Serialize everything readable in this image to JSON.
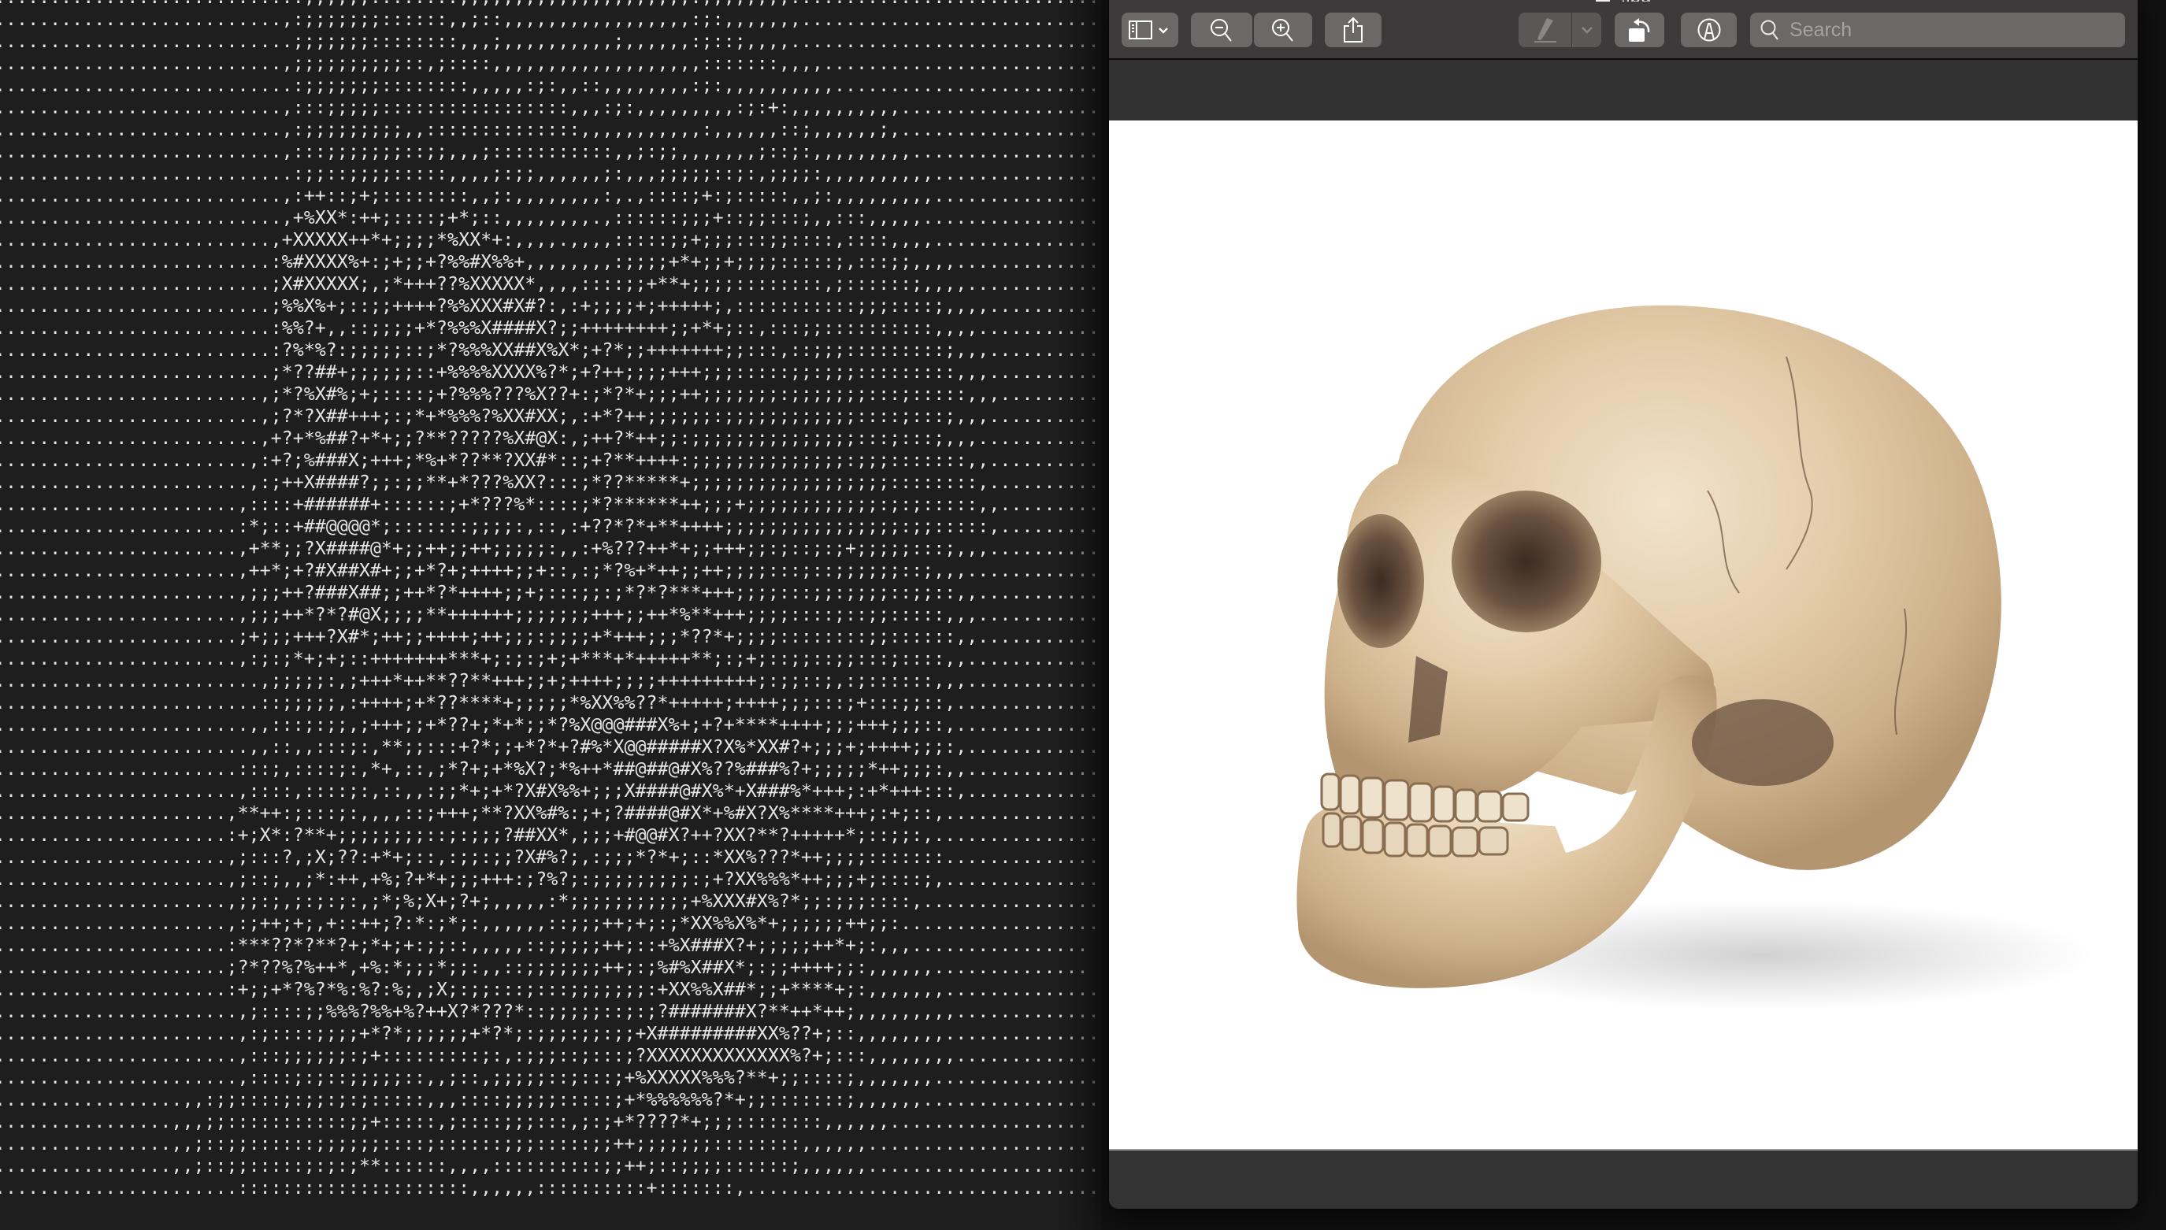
{
  "terminal": {
    "lines": [
      "..........................:;;;;;,;::::::,,,,,,,,,,,,,,,,,,,,,,:;,,,,,,,...............................",
      "...........................:;;;;;,::::::::,,,,,,,,,,,,,,,,,,,,,:;,,,,,,,..............................",
      "..........................,:;;;;;;;::::::,,;::,,,,,,,,,,,,,,,,,:;:,,,,,,,............................",
      "...........................;;;;;;;::::::::,,,;,,,,,,,,,,;,,,,,,:;::;,,,,.............................",
      "..........................,;;;;;;;;;;::,;::::,,,,,,,,,,,,,,,,,,,:::::::,,,,..........................",
      "...........................:;;;;;;;::::::::,,,,,:;:,,::,,,,,,,,:;:,,,,,,,,,,.........................",
      "..........................,:::;;;;;:::::::::::::::::,,,:;:,,,,,,,,,:;:+:,,,,,,,,,,....................",
      "..........................,:;;;;;;;;;,,::::::::::::::,,,,,,,,,,,:,,,,,,::;,,,,,,;,...................",
      "..........................,:::;;;;;;;::;;,,,;:::::::::::,,;:;;,,,,,,,;::;:,,,,,,,,,..................",
      "...........................:;;::;;;;:::::,,,,;:;;,,,,,,;:,,,;;;;;::;:,;;;;:,,,,,,,,,,...............",
      "..........................,:++::;+;::::::::,,;:,,,,,,,,:,.,::::;+:;:::::,,;:,,,,,,,,,...............",
      "..........................,+%XX*:++;::::;+*;::,,,,,,,,.,::::::;;;+::;;:::;,,:::,,,,,................",
      ".........................,+XXXXX++*+;;;;*%XX*+:,,,,.,,,,:::::;;+;;;:::;;::::,::::,,,,...............",
      ".........................:%#XXXX%+:;+;;+?%%#X%%+,,,,,,,,:;;;;+*+;;+;;;;:::::;,:::;;,,,,..............",
      ".........................;X#XXXXX;,;*+++??%XXXXX*,,,,::::;;+**+;;;;::::::::,;::::::;,,,,.............",
      ".........................;%%X%+;::;;++++?%%XXX#X#?:,:+;;;;+;+++++;,:::::::::::;;;::::;,,,,...........",
      ".........................:%%?+,,::;;;;+*?%%%X####X?;;++++++++;;+*+;::,:::;;::::::::::,,,,............",
      ".........................:?%*%?:;;;;;::;*?%%%XX##X%X*;+?*;;+++++++;;:::,::;;;:::::::::;,,,...........",
      ".........................;*??##+;;;;;;::+%%%%XXXX%?*;+?++;;;;+++;;;:::::;;:;;;:::::::::,,,...........",
      "........................,;*?%X#%;+;::::;+?%%%???%X??+:;*?*+;;;++;;;;;;;:;;;;;;;:::;:::::,,,..........",
      "........................,;?*?X##+++;:;*+*%%%?%XX#XX;,:+*?++;;;;;;:;;;;;;;;;;;;::::;:::;,,,...........",
      "........................,+?+*%##?+*+;;?**?????%X#@X:,;++?*++;;:;;;;;;;;;;;;;;;:::;:::;,,,............",
      ".......................,:+?;%###X;+++;*%+*??**?XX#*::;+?**++++:;;;;;;;;;;;;;;:;;;:::::::,,...........",
      ".......................,:;++X####?;;:;;**+*???%XX?:::;*??*****+;;;;;;;;;;;;;;;;;;::::::::,...........",
      "......................,::::+######+::::::;+*???%*::::;*?******++;;;+;;;;;;;;;;;;:;:;:::::,,...........",
      "......................:*;::+##@@@@*;:::::::;;;;:,::,:+??*?*+**++++;;;;;;;;;;;;;;;;:;;:::::,...........",
      "......................,+**;;?X####@*+;;++;;++;;;;;:,,:+%???++*+;;+++;;:;::;:;+;;;;;:::;,,,...........",
      "......................,++*;+?#X##X#+;;+*?+;++++;;+::,:;*?%+*++;;++;;;;:::;::;;;;;;::;,,,.............",
      "......................,;;;++?###X##;;++*?*++++;;+;:::;;:;*?*?***+++;;;;:::;;:;;;;::;;::,,............",
      "......................,;;;++*?*?#@X;;;;**++++++;;;;;;;+++;;++*%**+++;;;;::::;::;;:::::,,,............",
      "......................;+;;;+++?X#*;++;;++++;++;;;:;;;;+*+++;;;*??*+;;;;::::::::;;::::::,,............",
      "......................,:;:;*+;+;::+++++++***+;:;:;+;+***+*+++++**;:;+;::;;::;;:::;::::,,............",
      "........................,;;;;;:,;+++*++**??**+++;;+;++++;;;;+++++++++;:;;::;,:;::::::,,,............",
      "........................::;;;;;,:++++;+*??****+;;;;;*%XX%%??*+++++;++++;;;:::;+:::;;::,..............",
      ".......................,,:::;:;;,;+++;;+*??+;*+*;;*?%X@@@###X%+;+?+****++++;;;+++;;;::,.............",
      ".......................,,::,,:::;:,**;;:::+?*;;+*?*+?#%*X@@#####X?X%*XX#?+;;;+;++++;;;:,............",
      "......................:::;,::::;:,*+,::,;*?+;+*%X?;*%++*##@##@#X%??%###%?+;;;;;*++;;;:,,............",
      "......................,::::,::::;:,::,,:;;*+;+*?X#X%%+;;;X####@#X%*+X###%*+++;:+*+++:::,.............",
      ".....................,**++:;:::;:,,,,::;+++;**?XX%#%:;+;?####@#X*+%#X?X%****+++;:+;::,...............",
      ".....................:+;X*:?**+;;;;;;;;::;:;;;?##XX*,;;;+#@@#X?++?XX?**?+++++*;::;;:,................",
      ".....................,;:::?,;X;??:+*+;::,:;;:;;?X#%?;,:;;;*?*+;::*XX%???*++;;;;:::::::...............",
      ".....................,;::;,,;*:++,+%;?+*+;;;+++:;?%?;:;;;;;;;;;:;+?XX%%%*++;;;+;::::;,...............",
      ".....................,;;:;,;:;:;:,;*;%;X+;?+;,,,,,:*;;;;;;;;;;;+%XXX#X%?*;;:;;;::::,................",
      ".....................,:;++;+;,+::++;?:*:;*;:,,,,,,::;;;++;+;:;*XX%%X%*+;;;;;;++;;:..................",
      ".....................:***??*?**?+;*+;+:;;::,,,,,::;;;;;++;::+%X###X?+;;;;;++*+;:,,,................",
      ".....................;?*??%?%++*,+%:*;;;*;;:,,::;;;;;;;++;:;%#%X##X*;:;;++++;;:,,,,,,..............",
      ".....................:+;;+*?%?*%:%?:%;,;X;:;;:::;:::;;;;;;;:+XX%%X##*;;+****+;:,,,,,,,..............",
      "......................,;::::;;%%%?%%+%?++X?*???*::;;;;;::;:;?#######X?**++*++;,,,,,,,,,.............",
      "......................,:;::::;;;;+*?*;;;;;;+*?*;:;;;:;;:;;+X#########XX%??+;::,,,,,,,,..............",
      "......................,:::;;;;;;:;+:::::::::;:,:;;;::;:::;?XXXXXXXXXXXXX%?+;:::,,,,,,,,.............",
      "......................,::::;:;::;;;;;::,,;::,;;;;;::;:::;+%XXXXX%%%?**+;;::::;,,,,,,,...............",
      ".................,,:;;::::;:;;:;:;:::::,,,::::;;;;;:::::;+*%%%%%%?*+;;:::::::;,,,,,,................",
      "................,,,;;:::::::::::;;+:::::,;::::;;;:::,;:;+*????*+;;;::::::::,,,,,,..................",
      "................,,;::;;::::::;;;;;;::::;::::::;;;:::::;;++;;;;;;;::::::::,,,,,,....................",
      "................,,;::;;:::::;:;:;**::::::,,,,::::::::::;;++;::;;;;::::::;,,,,,,.....................",
      "......................:::::::::::::::::::::,,,,,,::::::::::+:::::::,.................................."
    ]
  },
  "preview": {
    "title": ".jpg",
    "toolbar": {
      "sidebar_button": "sidebar-toggle",
      "zoom_out_button": "zoom-out",
      "zoom_in_button": "zoom-in",
      "share_button": "share",
      "highlight_button": "highlight",
      "rotate_button": "rotate-left",
      "markup_button": "markup",
      "search_placeholder": "Search",
      "search_value": ""
    },
    "image": {
      "subject": "human skull",
      "background": "#ffffff"
    }
  },
  "colors": {
    "terminal_bg": "#1e1e1e",
    "terminal_fg": "#e6e6e6",
    "toolbar_bg": "#3c3a3a",
    "button_bg": "#6b6868",
    "window_bg": "#323232"
  }
}
